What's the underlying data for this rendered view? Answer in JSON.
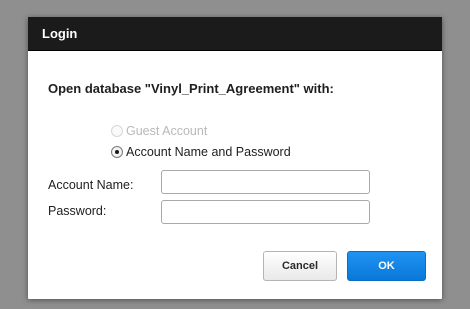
{
  "dialog": {
    "title": "Login",
    "prompt": "Open database \"Vinyl_Print_Agreement\" with:",
    "options": {
      "guest_label": "Guest Account",
      "guest_enabled": false,
      "guest_selected": false,
      "account_password_label": "Account Name and Password",
      "account_password_selected": true
    },
    "fields": {
      "account_name_label": "Account Name:",
      "account_name_value": "",
      "password_label": "Password:",
      "password_value": ""
    },
    "buttons": {
      "cancel_label": "Cancel",
      "ok_label": "OK"
    }
  },
  "colors": {
    "titlebar": "#1b1b1b",
    "primary_button": "#0a78d8",
    "backdrop": "#8f8f8f"
  }
}
